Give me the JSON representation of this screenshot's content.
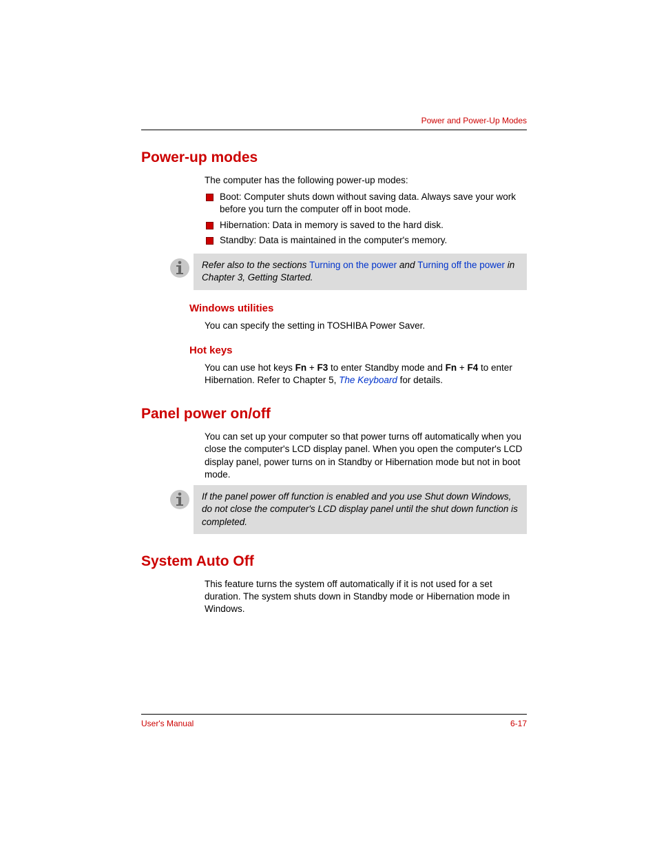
{
  "header": {
    "chapter_title": "Power and Power-Up Modes"
  },
  "s1": {
    "title": "Power-up modes",
    "intro": "The computer has the following power-up modes:",
    "bullets": [
      "Boot: Computer shuts down without saving data. Always save your work before you turn the computer off in boot mode.",
      "Hibernation: Data in memory is saved to the hard disk.",
      "Standby: Data is maintained in the computer's memory."
    ],
    "note": {
      "pre": "Refer also to the sections ",
      "link1": "Turning on the power",
      "mid": " and ",
      "link2": "Turning off the power",
      "post": " in Chapter 3, Getting Started."
    },
    "sub1": {
      "title": "Windows utilities",
      "text": "You can specify the setting in TOSHIBA Power Saver."
    },
    "sub2": {
      "title": "Hot keys",
      "t1": "You can use hot keys ",
      "fn1": "Fn",
      "plus1": " + ",
      "f3": "F3",
      "t2": " to enter Standby mode and ",
      "fn2": "Fn",
      "plus2": " + ",
      "f4": "F4",
      "t3": " to enter Hibernation. Refer to Chapter 5, ",
      "link": "The Keyboard",
      "t4": "  for details."
    }
  },
  "s2": {
    "title": "Panel power on/off",
    "body": "You can set up your computer so that power turns off automatically when you close the computer's LCD display panel. When you open the computer's LCD display panel, power turns on in Standby or Hibernation mode but not in boot mode.",
    "note": "If the panel power off function is enabled and you use Shut down Windows, do not close the computer's LCD display panel until the shut down function is completed."
  },
  "s3": {
    "title": "System Auto Off",
    "body": "This feature turns the system off automatically if it is not used for a set duration. The system shuts down in Standby mode or Hibernation mode in Windows."
  },
  "footer": {
    "left": "User's Manual",
    "right": "6-17"
  }
}
